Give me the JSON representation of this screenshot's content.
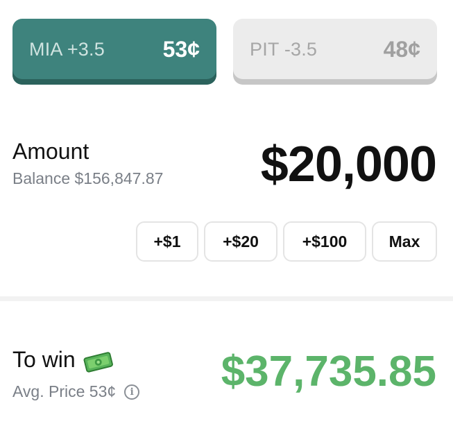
{
  "outcomes": [
    {
      "team": "MIA +3.5",
      "price": "53¢",
      "selected": true
    },
    {
      "team": "PIT -3.5",
      "price": "48¢",
      "selected": false
    }
  ],
  "amount": {
    "title": "Amount",
    "balance": "Balance $156,847.87",
    "value": "$20,000"
  },
  "quick_add": {
    "plus_1": "+$1",
    "plus_20": "+$20",
    "plus_100": "+$100",
    "max": "Max"
  },
  "to_win": {
    "title": "To win",
    "icon": "money-icon",
    "avg_price": "Avg. Price 53¢",
    "info_icon_glyph": "i",
    "value": "$37,735.85"
  },
  "colors": {
    "selected_bg": "#3e837d",
    "unselected_bg": "#ececec",
    "win_green": "#5cb46a"
  }
}
